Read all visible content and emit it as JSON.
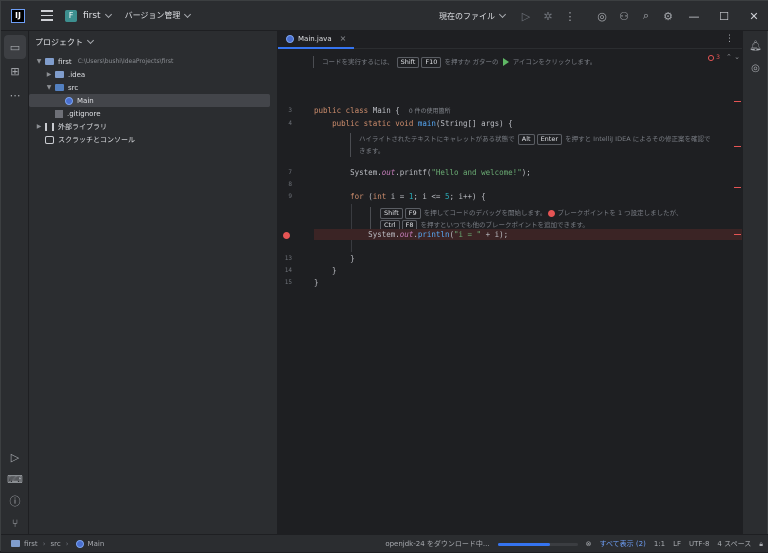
{
  "titlebar": {
    "project_badge": "F",
    "project_name": "first",
    "vcs_label": "バージョン管理",
    "run_config": "現在のファイル"
  },
  "project_panel": {
    "title": "プロジェクト",
    "tree": {
      "root_name": "first",
      "root_path": "C:\\Users\\bushi\\IdeaProjects\\first",
      "idea": ".idea",
      "src": "src",
      "main": "Main",
      "gitignore": ".gitignore",
      "ext_libs": "外部ライブラリ",
      "scratches": "スクラッチとコンソール"
    }
  },
  "editor": {
    "tab_label": "Main.java",
    "error_count": "3",
    "line_numbers": [
      "3",
      "4",
      "7",
      "8",
      "9",
      "13",
      "14",
      "15"
    ],
    "hint_top": {
      "pre": "コードを実行するには、",
      "key1": "Shift",
      "key2": "F10",
      "mid": "を押すか ガターの",
      "post": "アイコンをクリックします。"
    },
    "line3": {
      "usage_hint": "0 件の使用箇所"
    },
    "hint_middle": {
      "pre": "ハイライトされたテキストにキャレットがある状態で",
      "key1": "Alt",
      "key2": "Enter",
      "post": "を押すと IntelliJ IDEA によるその修正案を確認で",
      "line2": "きます。"
    },
    "printf_string": "\"Hello and welcome!\"",
    "hint_debug": {
      "key1": "Shift",
      "key2": "F9",
      "text1": "を押してコードのデバッグを開始します。",
      "text2": "ブレークポイントを 1 つ設定しましたが、",
      "key3": "Ctrl",
      "key4": "F8",
      "text3": "を押すといつでも他のブレークポイントを追加できます。"
    },
    "println_string": "\"i = \""
  },
  "status_bar": {
    "crumb_root": "first",
    "crumb_src": "src",
    "crumb_main": "Main",
    "task": "openjdk-24 をダウンロード中...",
    "progress": 0.65,
    "show_all": "すべて表示 (2)",
    "position": "1:1",
    "line_sep": "LF",
    "encoding": "UTF-8",
    "indent": "4 スペース"
  },
  "colors": {
    "accent": "#3574f0",
    "breakpoint": "#e55454",
    "keyword": "#cf8e6d",
    "string": "#6aab73"
  }
}
